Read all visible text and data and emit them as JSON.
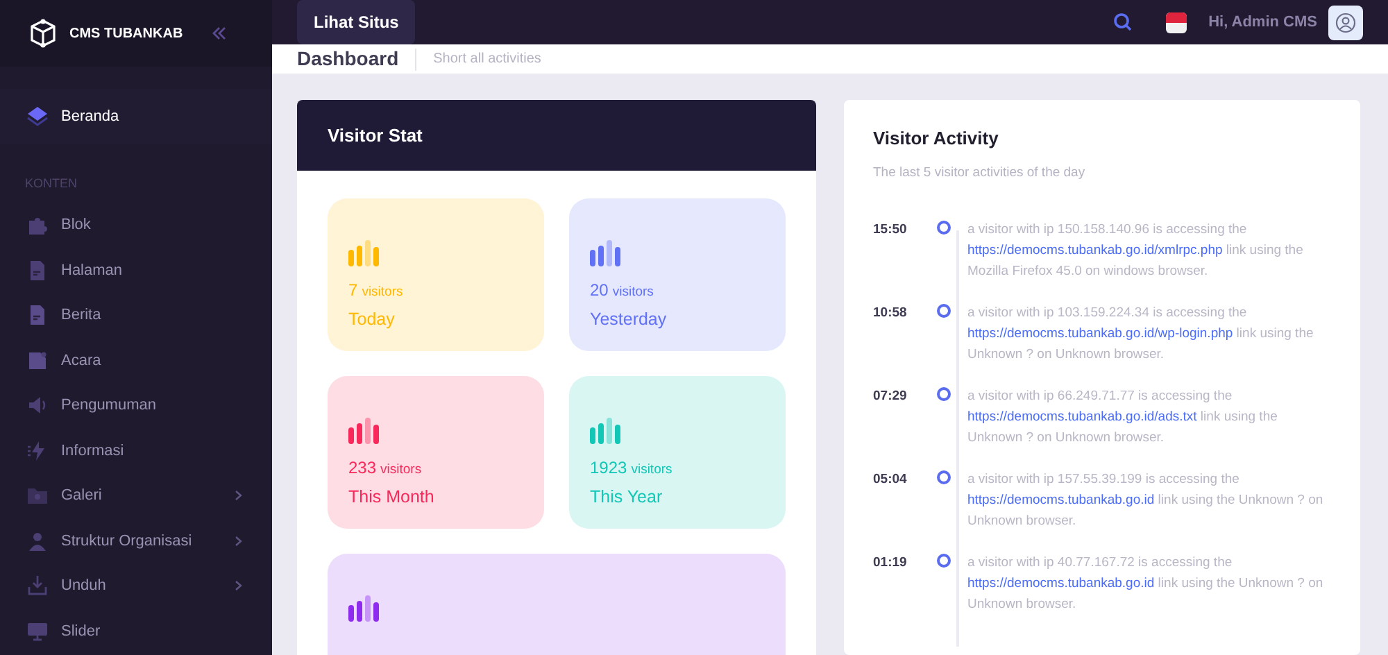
{
  "brand": {
    "name": "CMS TUBANKAB"
  },
  "topbar": {
    "site_button": "Lihat Situs",
    "greeting": "Hi, Admin CMS"
  },
  "sidebar": {
    "items": [
      {
        "kind": "item",
        "label": "Beranda",
        "selected": true,
        "submenu": false
      },
      {
        "kind": "section",
        "label": "KONTEN"
      },
      {
        "kind": "item",
        "label": "Blok",
        "selected": false,
        "submenu": false
      },
      {
        "kind": "item",
        "label": "Halaman",
        "selected": false,
        "submenu": false
      },
      {
        "kind": "item",
        "label": "Berita",
        "selected": false,
        "submenu": false
      },
      {
        "kind": "item",
        "label": "Acara",
        "selected": false,
        "submenu": false
      },
      {
        "kind": "item",
        "label": "Pengumuman",
        "selected": false,
        "submenu": false
      },
      {
        "kind": "item",
        "label": "Informasi",
        "selected": false,
        "submenu": false
      },
      {
        "kind": "item",
        "label": "Galeri",
        "selected": false,
        "submenu": true
      },
      {
        "kind": "item",
        "label": "Struktur Organisasi",
        "selected": false,
        "submenu": true
      },
      {
        "kind": "item",
        "label": "Unduh",
        "selected": false,
        "submenu": true
      },
      {
        "kind": "item",
        "label": "Slider",
        "selected": false,
        "submenu": false
      }
    ]
  },
  "subheader": {
    "title": "Dashboard",
    "subtitle": "Short all activities"
  },
  "visitor_stat": {
    "title": "Visitor Stat",
    "cards": [
      {
        "count": "7",
        "unit": "visitors",
        "period": "Today",
        "color": "#ffb800"
      },
      {
        "count": "20",
        "unit": "visitors",
        "period": "Yesterday",
        "color": "#6171f5"
      },
      {
        "count": "233",
        "unit": "visitors",
        "period": "This Month",
        "color": "#f8285a"
      },
      {
        "count": "1923",
        "unit": "visitors",
        "period": "This Year",
        "color": "#12c7b5"
      },
      {
        "color": "#8f2bef"
      }
    ]
  },
  "visitor_activity": {
    "title": "Visitor Activity",
    "subtitle": "The last 5 visitor activities of the day",
    "entries": [
      {
        "time": "15:50",
        "before": "a visitor with ip 150.158.140.96 is accessing the",
        "link": "https://democms.tubankab.go.id/xmlrpc.php",
        "after": "link using the Mozilla Firefox 45.0 on windows browser."
      },
      {
        "time": "10:58",
        "before": "a visitor with ip 103.159.224.34 is accessing the",
        "link": "https://democms.tubankab.go.id/wp-login.php",
        "after": "link using the Unknown ? on Unknown browser."
      },
      {
        "time": "07:29",
        "before": "a visitor with ip 66.249.71.77 is accessing the",
        "link": "https://democms.tubankab.go.id/ads.txt",
        "after": "link using the Unknown ? on Unknown browser."
      },
      {
        "time": "05:04",
        "before": "a visitor with ip 157.55.39.199 is accessing the",
        "link": "https://democms.tubankab.go.id",
        "after": "link using the Unknown ? on Unknown browser."
      },
      {
        "time": "01:19",
        "before": "a visitor with ip 40.77.167.72 is accessing the",
        "link": "https://democms.tubankab.go.id",
        "after": "link using the Unknown ? on Unknown browser."
      }
    ]
  }
}
